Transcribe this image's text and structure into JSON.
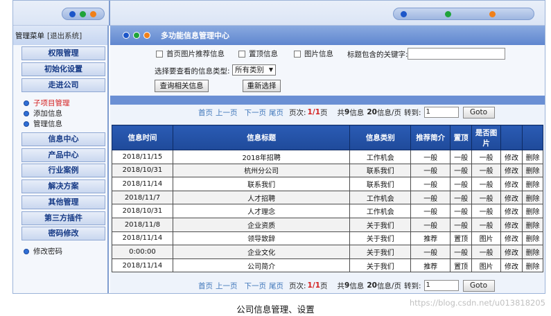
{
  "sidebar": {
    "menu_title": "管理菜单",
    "logout": "[退出系统]",
    "buttons": [
      "权限管理",
      "初始化设置",
      "走进公司"
    ],
    "sub_items": [
      "子项目管理",
      "添加信息",
      "管理信息"
    ],
    "buttons2": [
      "信息中心",
      "产品中心",
      "行业案例",
      "解决方案",
      "其他管理",
      "第三方插件",
      "密码修改"
    ],
    "extra_item": "修改密码"
  },
  "main": {
    "title": "多功能信息管理中心",
    "filters": {
      "check1": "首页图片推荐信息",
      "check2": "置顶信息",
      "check3": "图片信息",
      "keyword_label": "标题包含的关键字:",
      "keyword_value": "",
      "type_label": "选择要查看的信息类型:",
      "type_selected": "所有类别",
      "query_button": "查询相关信息",
      "reset_button": "重新选择"
    },
    "pager": {
      "first": "首页",
      "prev": "上一页",
      "next": "下一页",
      "last": "尾页",
      "page_label": "页次:",
      "page_current": "1/1",
      "page_suffix": "页",
      "total_prefix": "共",
      "total_count": "9",
      "total_suffix": "信息",
      "per_page": "20",
      "per_page_suffix": "信息/页",
      "goto_label": "转到:",
      "goto_value": "1",
      "goto_button": "Goto"
    },
    "table": {
      "headers": [
        "信息时间",
        "信息标题",
        "信息类别",
        "推荐简介",
        "置顶",
        "是否图片",
        "",
        ""
      ],
      "rows": [
        [
          "2018/11/15",
          "2018年招聘",
          "工作机会",
          "一般",
          "一般",
          "一般",
          "修改",
          "删除"
        ],
        [
          "2018/10/31",
          "杭州分公司",
          "联系我们",
          "一般",
          "一般",
          "一般",
          "修改",
          "删除"
        ],
        [
          "2018/11/14",
          "联系我们",
          "联系我们",
          "一般",
          "一般",
          "一般",
          "修改",
          "删除"
        ],
        [
          "2018/11/7",
          "人才招聘",
          "工作机会",
          "一般",
          "一般",
          "一般",
          "修改",
          "删除"
        ],
        [
          "2018/10/31",
          "人才理念",
          "工作机会",
          "一般",
          "一般",
          "一般",
          "修改",
          "删除"
        ],
        [
          "2018/11/8",
          "企业资质",
          "关于我们",
          "一般",
          "一般",
          "一般",
          "修改",
          "删除"
        ],
        [
          "2018/11/14",
          "领导致辞",
          "关于我们",
          "推荐",
          "置顶",
          "图片",
          "修改",
          "删除"
        ],
        [
          "0:00:00",
          "企业文化",
          "关于我们",
          "一般",
          "一般",
          "一般",
          "修改",
          "删除"
        ],
        [
          "2018/11/14",
          "公司简介",
          "关于我们",
          "推荐",
          "置顶",
          "图片",
          "修改",
          "删除"
        ]
      ]
    }
  },
  "caption": "公司信息管理、设置",
  "watermark": "https://blog.csdn.net/u013818205",
  "colors": {
    "accent": "#2a5bb4",
    "link": "#3c74b9",
    "highlight": "#d41e1e"
  }
}
